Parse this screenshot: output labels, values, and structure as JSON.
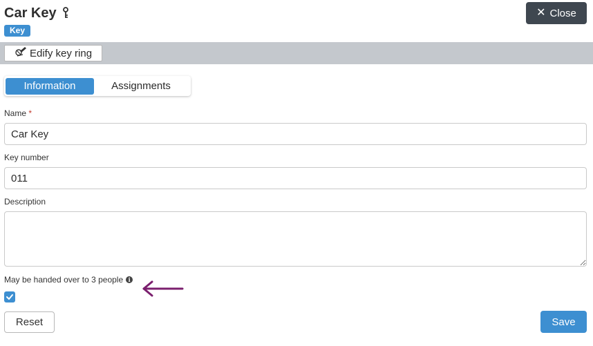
{
  "header": {
    "title": "Car Key",
    "title_icon": "key-icon",
    "badge": "Key",
    "close_label": "Close"
  },
  "toolbar": {
    "edit_key_ring_label": "Edify key ring",
    "edit_icon": "key-ring-pen-icon"
  },
  "tabs": [
    {
      "label": "Information",
      "active": true
    },
    {
      "label": "Assignments",
      "active": false
    }
  ],
  "form": {
    "name_label": "Name",
    "name_required_marker": "*",
    "name_value": "Car Key",
    "key_number_label": "Key number",
    "key_number_value": "011",
    "description_label": "Description",
    "description_value": "",
    "handover_label": "May be handed over to 3 people",
    "handover_checked": true
  },
  "actions": {
    "reset_label": "Reset",
    "save_label": "Save"
  },
  "colors": {
    "accent": "#3d8fd1",
    "close_button": "#3f4750",
    "toolbar_bg": "#c4c8cd",
    "annotation_arrow": "#7b1f6e"
  }
}
